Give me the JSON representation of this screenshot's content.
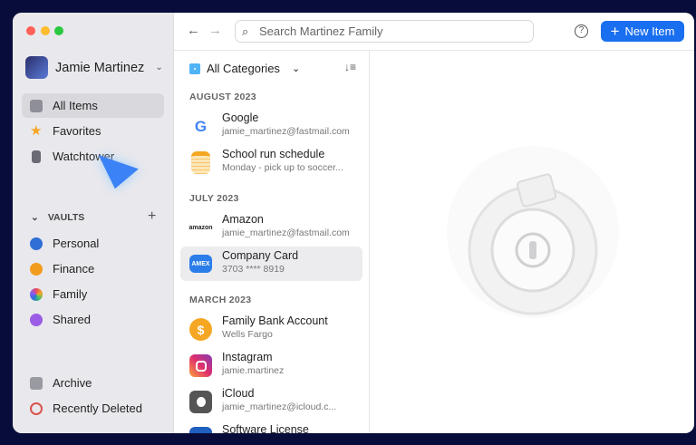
{
  "window": {
    "traffic_lights": [
      "#fe5f57",
      "#febc2e",
      "#28c840"
    ]
  },
  "sidebar": {
    "account": "Jamie Martinez",
    "items": [
      {
        "label": "All Items",
        "icon": "all-items-icon",
        "selected": true
      },
      {
        "label": "Favorites",
        "icon": "star-icon"
      },
      {
        "label": "Watchtower",
        "icon": "watchtower-icon"
      }
    ],
    "vaults_label": "VAULTS",
    "vaults": [
      {
        "label": "Personal",
        "color": "#2f6fd6"
      },
      {
        "label": "Finance",
        "color": "#f29c1f"
      },
      {
        "label": "Family",
        "color": "#8a5cf6"
      },
      {
        "label": "Shared",
        "color": "#9b5de5"
      }
    ],
    "bottom": [
      {
        "label": "Archive",
        "icon": "archive-icon"
      },
      {
        "label": "Recently Deleted",
        "icon": "trash-icon"
      }
    ]
  },
  "header": {
    "search_placeholder": "Search Martinez Family",
    "new_item": "New Item",
    "accent": "#1a6ff0"
  },
  "list": {
    "category": "All Categories",
    "sections": [
      {
        "label": "AUGUST 2023",
        "items": [
          {
            "title": "Google",
            "subtitle": "jamie_martinez@fastmail.com",
            "logo": "G"
          },
          {
            "title": "School run schedule",
            "subtitle": "Monday - pick up to soccer...",
            "logo": ""
          }
        ]
      },
      {
        "label": "JULY 2023",
        "items": [
          {
            "title": "Amazon",
            "subtitle": "jamie_martinez@fastmail.com",
            "logo": "amazon"
          },
          {
            "title": "Company Card",
            "subtitle": "3703 **** 8919",
            "logo": "AMEX",
            "selected": true
          }
        ]
      },
      {
        "label": "MARCH 2023",
        "items": [
          {
            "title": "Family Bank Account",
            "subtitle": "Wells Fargo",
            "logo": "$"
          },
          {
            "title": "Instagram",
            "subtitle": "jamie.martinez",
            "logo": ""
          },
          {
            "title": "iCloud",
            "subtitle": "jamie_martinez@icloud.c...",
            "logo": ""
          },
          {
            "title": "Software License",
            "subtitle": "",
            "logo": ""
          }
        ]
      }
    ]
  }
}
